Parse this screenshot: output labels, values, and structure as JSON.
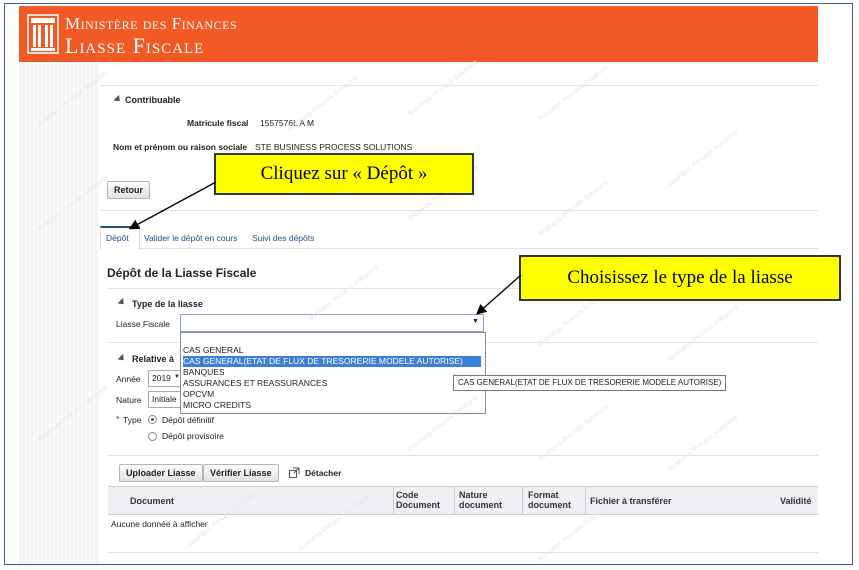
{
  "header": {
    "line1": "Ministère des Finances",
    "line2": "Liasse Fiscale",
    "bg_color": "#f15a24",
    "logo_icon": "columns-building-icon"
  },
  "contribuable": {
    "section_title": "Contribuable",
    "matricule_label": "Matricule fiscal",
    "matricule_value": "1557576L A M",
    "nom_label": "Nom et prénom ou raison sociale",
    "nom_value": "STE BUSINESS PROCESS SOLUTIONS",
    "retour_label": "Retour"
  },
  "tabs": [
    {
      "label": "Dépôt",
      "active": true
    },
    {
      "label": "Valider le dépôt en cours",
      "active": false
    },
    {
      "label": "Suivi des dépôts",
      "active": false
    }
  ],
  "page_title": "Dépôt de la Liasse Fiscale",
  "type_liasse": {
    "section_title": "Type de la liasse",
    "field_label": "Liasse Fiscale",
    "options": [
      "CAS GENERAL",
      "CAS GENERAL(ETAT DE FLUX DE TRESORERIE MODELE AUTORISE)",
      "BANQUES",
      "ASSURANCES ET REASSURANCES",
      "OPCVM",
      "MICRO CREDITS"
    ],
    "highlighted_index": 1,
    "tooltip": "CAS GENERAL(ETAT DE FLUX DE TRESORERIE MODELE AUTORISE)"
  },
  "relative": {
    "section_title": "Relative à",
    "annee_label": "Année",
    "annee_value": "2019",
    "nature_label": "Nature",
    "nature_value": "Initiale",
    "type_label": "Type",
    "type_required": "*",
    "type_options": [
      "Dépôt définitif",
      "Dépôt provisoire"
    ],
    "type_selected": 0
  },
  "toolbar": {
    "upload_label": "Uploader Liasse",
    "verify_label": "Vérifier Liasse",
    "detach_label": "Détacher"
  },
  "table": {
    "columns": [
      "Document",
      "Code Document",
      "Nature document",
      "Format document",
      "Fichier à transférer",
      "Validité"
    ],
    "empty_text": "Aucune donnée à afficher"
  },
  "callouts": {
    "depot": "Cliquez sur « Dépôt »",
    "type": "Choisissez le type de la liasse"
  },
  "watermark_text": "Business Process Solutions"
}
